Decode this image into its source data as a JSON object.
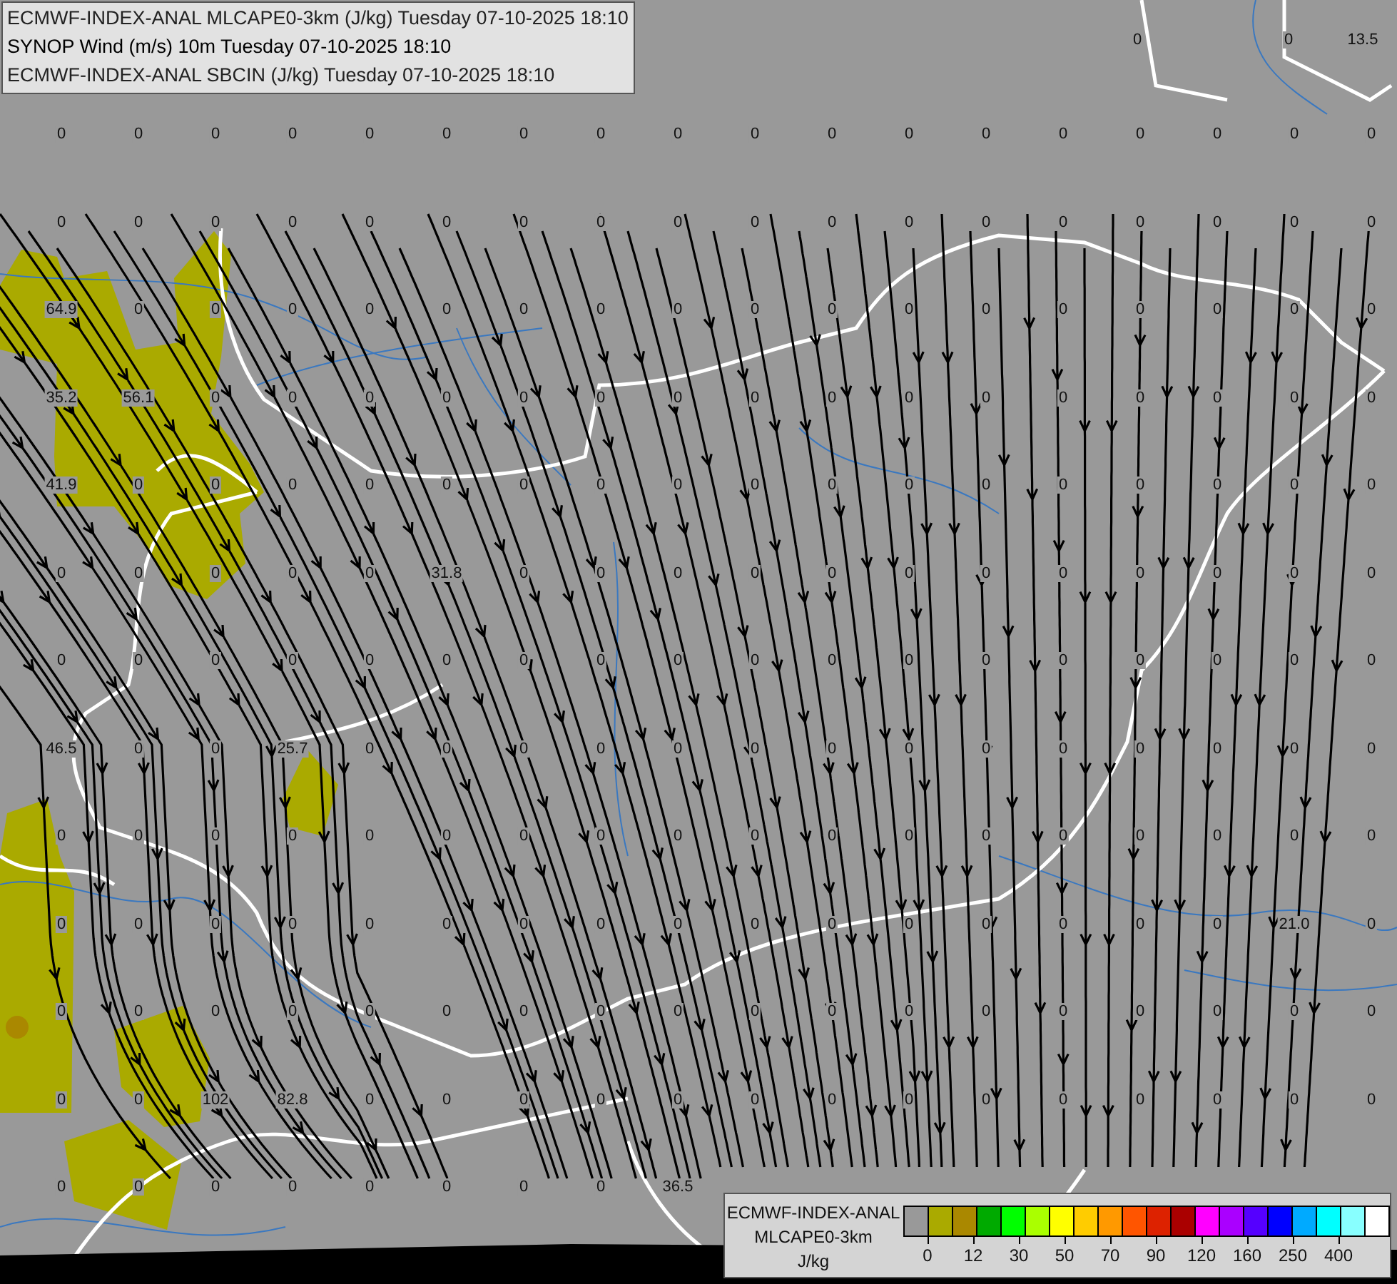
{
  "header_lines": [
    "ECMWF-INDEX-ANAL MLCAPE0-3km (J/kg) Tuesday 07-10-2025 18:10",
    "SYNOP Wind (m/s) 10m Tuesday 07-10-2025 18:10",
    "ECMWF-INDEX-ANAL SBCIN (J/kg) Tuesday 07-10-2025 18:10"
  ],
  "top_values": [
    "0",
    "0",
    "13.5"
  ],
  "station_values": [
    [
      "0",
      "0",
      "0",
      "0",
      "0",
      "0",
      "0",
      "0",
      "0",
      "0",
      "0",
      "0",
      "0",
      "0",
      "0",
      "0",
      "0",
      "0"
    ],
    [
      "0",
      "0",
      "0",
      "0",
      "0",
      "0",
      "0",
      "0",
      "0",
      "0",
      "0",
      "0",
      "0",
      "0",
      "0",
      "0",
      "0",
      "0"
    ],
    [
      "64.9",
      "0",
      "0",
      "0",
      "0",
      "0",
      "0",
      "0",
      "0",
      "0",
      "0",
      "0",
      "0",
      "0",
      "0",
      "0",
      "0",
      "0"
    ],
    [
      "35.2",
      "56.1",
      "0",
      "0",
      "0",
      "0",
      "0",
      "0",
      "0",
      "0",
      "0",
      "0",
      "0",
      "0",
      "0",
      "0",
      "0",
      "0"
    ],
    [
      "41.9",
      "0",
      "0",
      "0",
      "0",
      "0",
      "0",
      "0",
      "0",
      "0",
      "0",
      "0",
      "0",
      "0",
      "0",
      "0",
      "0",
      "0"
    ],
    [
      "0",
      "0",
      "0",
      "0",
      "0",
      "31.8",
      "0",
      "0",
      "0",
      "0",
      "0",
      "0",
      "0",
      "0",
      "0",
      "0",
      "0",
      "0"
    ],
    [
      "0",
      "0",
      "0",
      "0",
      "0",
      "0",
      "0",
      "0",
      "0",
      "0",
      "0",
      "0",
      "0",
      "0",
      "0",
      "0",
      "0",
      "0"
    ],
    [
      "46.5",
      "0",
      "0",
      "25.7",
      "0",
      "0",
      "0",
      "0",
      "0",
      "0",
      "0",
      "0",
      "0",
      "0",
      "0",
      "0",
      "0",
      "0"
    ],
    [
      "0",
      "0",
      "0",
      "0",
      "0",
      "0",
      "0",
      "0",
      "0",
      "0",
      "0",
      "0",
      "0",
      "0",
      "0",
      "0",
      "0",
      "0"
    ],
    [
      "0",
      "0",
      "0",
      "0",
      "0",
      "0",
      "0",
      "0",
      "0",
      "0",
      "0",
      "0",
      "0",
      "0",
      "0",
      "0",
      "21.0",
      "0"
    ],
    [
      "0",
      "0",
      "0",
      "0",
      "0",
      "0",
      "0",
      "0",
      "0",
      "0",
      "0",
      "0",
      "0",
      "0",
      "0",
      "0",
      "0",
      "0"
    ],
    [
      "0",
      "0",
      "102",
      "82.8",
      "0",
      "0",
      "0",
      "0",
      "0",
      "0",
      "0",
      "0",
      "0",
      "0",
      "0",
      "0",
      "0",
      "0"
    ],
    [
      "0",
      "0",
      "0",
      "0",
      "0",
      "0",
      "0",
      "0",
      "36.5"
    ]
  ],
  "legend": {
    "title": "ECMWF-INDEX-ANAL",
    "field": "MLCAPE0-3km",
    "unit": "J/kg",
    "swatches": [
      {
        "color": "#999999"
      },
      {
        "color": "#aaaa00"
      },
      {
        "color": "#aa8800"
      },
      {
        "color": "#00aa00"
      },
      {
        "color": "#00ff00"
      },
      {
        "color": "#aaff00"
      },
      {
        "color": "#ffff00"
      },
      {
        "color": "#ffcc00"
      },
      {
        "color": "#ff9900"
      },
      {
        "color": "#ff5500"
      },
      {
        "color": "#dd2200"
      },
      {
        "color": "#aa0000"
      },
      {
        "color": "#ff00ff"
      },
      {
        "color": "#aa00ff"
      },
      {
        "color": "#5500ff"
      },
      {
        "color": "#0000ff"
      },
      {
        "color": "#00aaff"
      },
      {
        "color": "#00ffff"
      },
      {
        "color": "#88ffff"
      },
      {
        "color": "#ffffff"
      }
    ],
    "ticks": [
      "0",
      "12",
      "30",
      "50",
      "70",
      "90",
      "120",
      "160",
      "250",
      "400"
    ]
  }
}
